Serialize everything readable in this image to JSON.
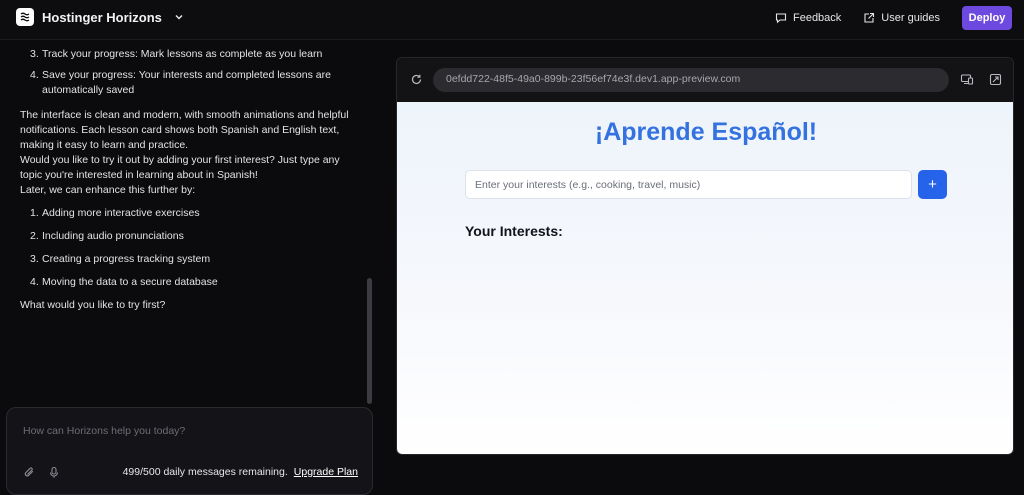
{
  "topbar": {
    "brand": "Hostinger Horizons",
    "feedback": "Feedback",
    "user_guides": "User guides",
    "deploy": "Deploy"
  },
  "chat": {
    "list1": [
      {
        "num": "3.",
        "text": "Track your progress: Mark lessons as complete as you learn"
      },
      {
        "num": "4.",
        "text": "Save your progress: Your interests and completed lessons are automatically saved"
      }
    ],
    "paragraphs": [
      "The interface is clean and modern, with smooth animations and helpful notifications. Each lesson card shows both Spanish and English text, making it easy to learn and practice.",
      "Would you like to try it out by adding your first interest? Just type any topic you're interested in learning about in Spanish!",
      "Later, we can enhance this further by:"
    ],
    "list2": [
      {
        "num": "1.",
        "text": "Adding more interactive exercises"
      },
      {
        "num": "2.",
        "text": "Including audio pronunciations"
      },
      {
        "num": "3.",
        "text": "Creating a progress tracking system"
      },
      {
        "num": "4.",
        "text": "Moving the data to a secure database"
      }
    ],
    "closing": "What would you like to try first?"
  },
  "composer": {
    "placeholder": "How can Horizons help you today?",
    "remaining": "499/500 daily messages remaining.",
    "upgrade": "Upgrade Plan"
  },
  "preview": {
    "url": "0efdd722-48f5-49a0-899b-23f56ef74e3f.dev1.app-preview.com",
    "app": {
      "title": "¡Aprende Español!",
      "input_placeholder": "Enter your interests (e.g., cooking, travel, music)",
      "add_label": "+",
      "interests_heading": "Your Interests:"
    }
  },
  "colors": {
    "accent": "#6e49e0",
    "app_title": "#3472e0",
    "add_button": "#2563eb"
  }
}
